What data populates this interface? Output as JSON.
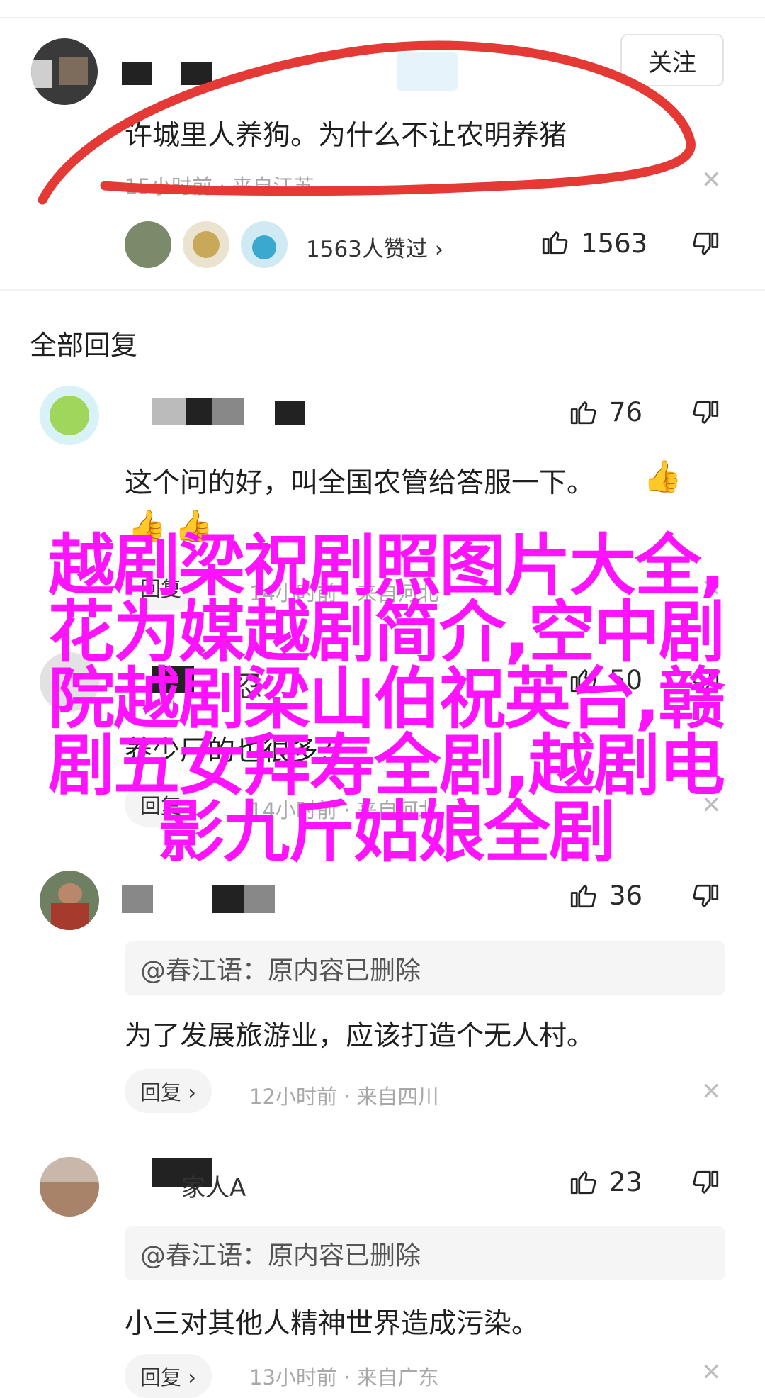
{
  "post": {
    "follow_label": "关注",
    "text": "许城里人养狗。为什么不让农明养猪",
    "meta": "15小时前 · 来自江苏",
    "likers_text": "1563人赞过 ›",
    "like_count": "1563"
  },
  "section_title": "全部回复",
  "comments": [
    {
      "likes": "76",
      "text": "这个问的好，叫全国农管给答服一下。",
      "reply_label": "回复",
      "meta": "14小时前 · 来自河北"
    },
    {
      "username": "忍",
      "likes": "50",
      "text": "养少厂的也很多？",
      "reply_label": "回复",
      "meta": "14小时前 · 来自河北"
    },
    {
      "likes": "36",
      "quote": "@春江语：原内容已删除",
      "text": "为了发展旅游业，应该打造个无人村。",
      "reply_label": "回复 ›",
      "meta": "12小时前 · 来自四川"
    },
    {
      "username": "家人A",
      "likes": "23",
      "quote": "@春江语：原内容已删除",
      "text": "小三对其他人精神世界造成污染。",
      "reply_label": "回复 ›",
      "meta": "13小时前 · 来自广东"
    }
  ],
  "overlay_text": "越剧梁祝剧照图片大全,花为媒越剧简介,空中剧院越剧梁山伯祝英台,赣剧五女拜寿全剧,越剧电影九斤姑娘全剧",
  "colors": {
    "overlay": "#ff13ff",
    "annotation": "#e53935"
  }
}
